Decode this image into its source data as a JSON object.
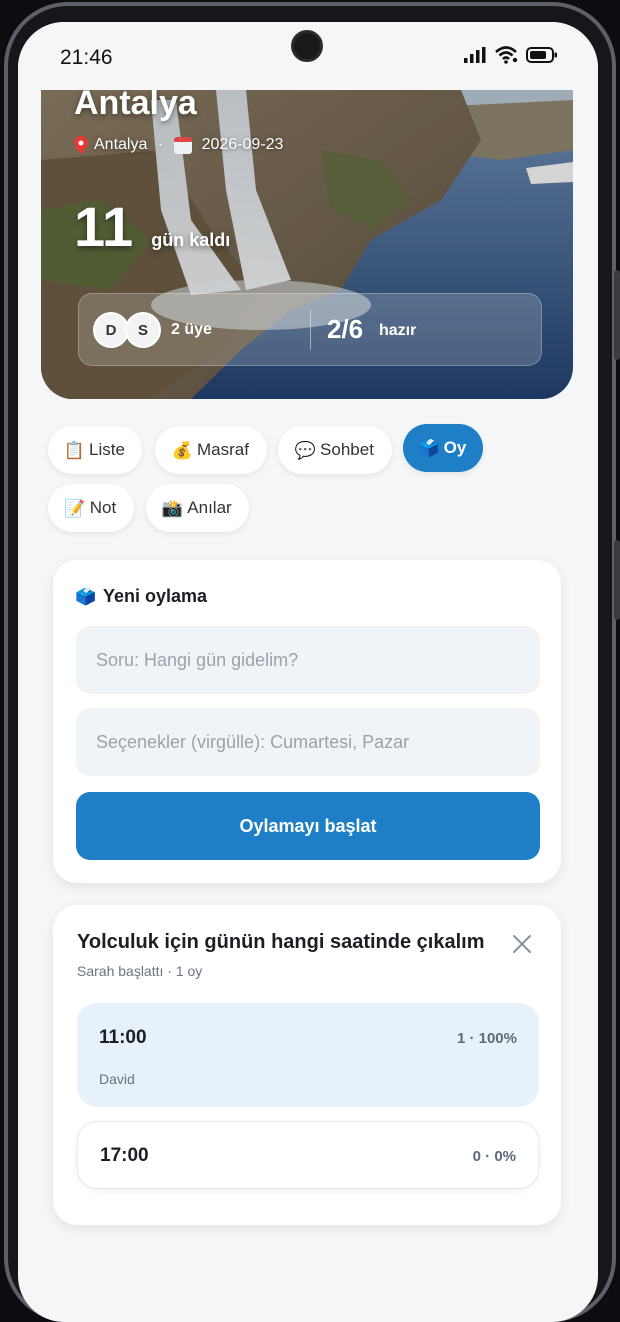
{
  "status_bar": {
    "time": "21:46"
  },
  "trip": {
    "title": "Antalya",
    "location": "Antalya",
    "date": "2026-09-23",
    "days_left": "11",
    "days_left_label": "gün kaldı",
    "members": [
      {
        "initial": "D"
      },
      {
        "initial": "S"
      }
    ],
    "members_label": "2 üye",
    "ready": "2/6",
    "ready_label": "hazır"
  },
  "tabs": [
    {
      "icon": "clipboard-icon",
      "label": "Liste",
      "active": false
    },
    {
      "icon": "money-bag-icon",
      "label": "Masraf",
      "active": false
    },
    {
      "icon": "chat-bubble-icon",
      "label": "Sohbet",
      "active": false
    },
    {
      "icon": "ballot-box-icon",
      "label": "Oy",
      "active": true
    },
    {
      "icon": "memo-icon",
      "label": "Not",
      "active": false
    },
    {
      "icon": "camera-icon",
      "label": "Anılar",
      "active": false
    }
  ],
  "new_poll": {
    "title": "Yeni oylama",
    "question_placeholder": "Soru: Hangi gün gidelim?",
    "options_placeholder": "Seçenekler (virgülle): Cumartesi, Pazar",
    "submit_label": "Oylamayı başlat"
  },
  "poll": {
    "question": "Yolculuk için günün hangi saatinde çıkalım",
    "meta": "Sarah başlattı · 1 oy",
    "options": [
      {
        "label": "11:00",
        "stat": "1 · 100%",
        "voters": "David",
        "share": 1.0
      },
      {
        "label": "17:00",
        "stat": "0 · 0%",
        "voters": "",
        "share": 0.0
      }
    ]
  },
  "colors": {
    "accent": "#1f7fc6",
    "lead_option_bg": "#e6f1fa",
    "screen_bg": "#f4f6f8"
  }
}
